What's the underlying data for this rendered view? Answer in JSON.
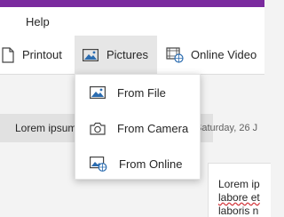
{
  "menu": {
    "help": "Help"
  },
  "ribbon": {
    "printout_label": "Printout",
    "pictures_label": "Pictures",
    "online_video_label": "Online Video"
  },
  "pictures_menu": {
    "items": [
      {
        "label": "From File",
        "icon": "image-icon"
      },
      {
        "label": "From Camera",
        "icon": "camera-icon"
      },
      {
        "label": "From Online",
        "icon": "online-image-icon"
      }
    ]
  },
  "content": {
    "section_label": "Lorem ipsum",
    "date": "Saturday, 26 J",
    "page_lines": [
      "Lorem ip",
      "labore et",
      "laboris n"
    ]
  },
  "colors": {
    "accent": "#7a2a9e",
    "selected": "#e6e6e6",
    "icon_blue": "#2b6cb0"
  }
}
